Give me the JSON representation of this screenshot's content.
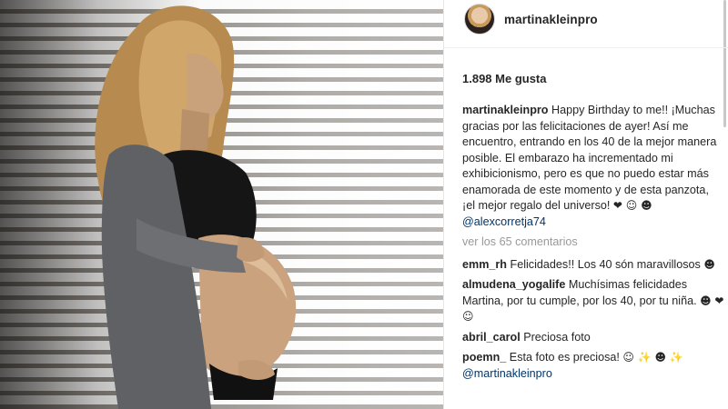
{
  "post": {
    "username": "martinakleinpro",
    "likes": "1.898 Me gusta"
  },
  "caption": {
    "user": "martinakleinpro",
    "text": "Happy Birthday to me!! ¡Muchas gracias por las felicitaciones de ayer! Así me encuentro, entrando en los 40 de la mejor manera posible. El embarazo ha incrementado mi exhibicionismo, pero es que no puedo estar más enamorada de este momento y de esta panzota, ¡el mejor regalo del universo!",
    "emojis": "❤ ☺ ☻",
    "mention": "@alexcorretja74"
  },
  "view_all": "ver los 65 comentarios",
  "comments": [
    {
      "user": "emm_rh",
      "text": "Felicidades!! Los 40 són maravillosos",
      "emojis": "☻",
      "mention": ""
    },
    {
      "user": "almudena_yogalife",
      "text": "Muchísimas felicidades Martina, por tu cumple, por los 40, por tu niña.",
      "emojis": "☻ ❤ ☺",
      "mention": ""
    },
    {
      "user": "abril_carol",
      "text": "Preciosa foto",
      "emojis": "",
      "mention": ""
    },
    {
      "user": "poemn_",
      "text": "Esta foto es preciosa!",
      "emojis": "☺ ✨ ☻ ✨",
      "mention": "@martinakleinpro"
    }
  ],
  "icons": {
    "avatar": "profile-avatar",
    "heart": "heart-emoji"
  }
}
